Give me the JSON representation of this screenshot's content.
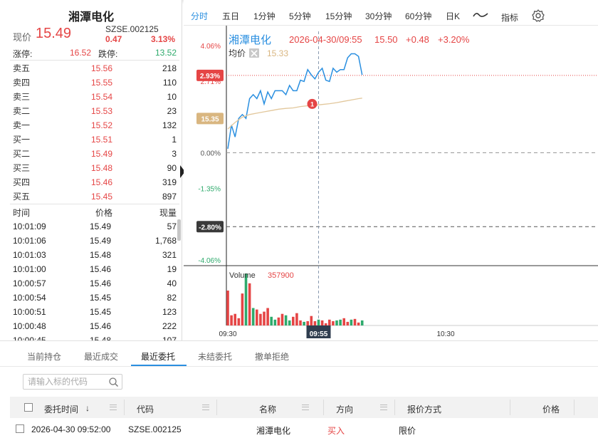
{
  "stock": {
    "name": "湘潭电化",
    "code": "SZSE.002125",
    "price_label": "现价",
    "price": "15.49",
    "change_abs": "0.47",
    "change_pct": "3.13%",
    "limit_up_label": "涨停:",
    "limit_up": "16.52",
    "limit_down_label": "跌停:",
    "limit_down": "13.52"
  },
  "orderbook": [
    {
      "label": "卖五",
      "price": "15.56",
      "volume": "218"
    },
    {
      "label": "卖四",
      "price": "15.55",
      "volume": "110"
    },
    {
      "label": "卖三",
      "price": "15.54",
      "volume": "10"
    },
    {
      "label": "卖二",
      "price": "15.53",
      "volume": "23"
    },
    {
      "label": "卖一",
      "price": "15.52",
      "volume": "132"
    },
    {
      "label": "买一",
      "price": "15.51",
      "volume": "1"
    },
    {
      "label": "买二",
      "price": "15.49",
      "volume": "3"
    },
    {
      "label": "买三",
      "price": "15.48",
      "volume": "90"
    },
    {
      "label": "买四",
      "price": "15.46",
      "volume": "319"
    },
    {
      "label": "买五",
      "price": "15.45",
      "volume": "897"
    }
  ],
  "ticks": {
    "headers": [
      "时间",
      "价格",
      "现量"
    ],
    "rows": [
      {
        "time": "10:01:09",
        "price": "15.49",
        "volume": "57"
      },
      {
        "time": "10:01:06",
        "price": "15.49",
        "volume": "1,768"
      },
      {
        "time": "10:01:03",
        "price": "15.48",
        "volume": "321"
      },
      {
        "time": "10:01:00",
        "price": "15.46",
        "volume": "19"
      },
      {
        "time": "10:00:57",
        "price": "15.46",
        "volume": "40"
      },
      {
        "time": "10:00:54",
        "price": "15.45",
        "volume": "82"
      },
      {
        "time": "10:00:51",
        "price": "15.45",
        "volume": "123"
      },
      {
        "time": "10:00:48",
        "price": "15.46",
        "volume": "222"
      },
      {
        "time": "10:00:45",
        "price": "15.48",
        "volume": "107"
      }
    ]
  },
  "periods": [
    "分时",
    "五日",
    "1分钟",
    "5分钟",
    "15分钟",
    "30分钟",
    "60分钟",
    "日K"
  ],
  "active_period": "分时",
  "indicator_label": "指标",
  "legend": {
    "name": "湘潭电化",
    "datetime": "2026-04-30/09:55",
    "price": "15.50",
    "change": "+0.48",
    "change_pct": "+3.20%",
    "avg_label": "均价",
    "avg_value": "15.33",
    "volume_label": "Volume",
    "volume_value": "357900"
  },
  "chart_data": {
    "type": "line",
    "y_ticks": [
      "4.06%",
      "2.71%",
      "1.35%",
      "0.00%",
      "-1.35%",
      "-2.71%",
      "-4.06%"
    ],
    "y_tick_values": [
      4.06,
      2.71,
      1.35,
      0.0,
      -1.35,
      -2.71,
      -4.06
    ],
    "ylim": [
      -4.06,
      4.06
    ],
    "x_ticks": [
      "09:30",
      "10:30"
    ],
    "x_tick_minutes": [
      0,
      60
    ],
    "crosshair": {
      "x_label": "09:55",
      "x_minute": 25
    },
    "price_tag": {
      "label": "2.93%",
      "value": 2.93
    },
    "avg_tag": {
      "label": "15.35",
      "value": 1.0
    },
    "low_tag": {
      "label": "-2.80%",
      "value": -2.8
    },
    "marker": {
      "label": "1",
      "minute": 25,
      "value": 1.85
    },
    "series": [
      {
        "name": "湘潭电化",
        "color": "#2a8fe0",
        "minutes": [
          0,
          1,
          2,
          3,
          4,
          5,
          6,
          7,
          8,
          9,
          10,
          11,
          12,
          13,
          14,
          15,
          16,
          17,
          18,
          19,
          20,
          21,
          22,
          23,
          24,
          25,
          26,
          27,
          28,
          29,
          30,
          31,
          32,
          33,
          34,
          35,
          36,
          37
        ],
        "values": [
          0.15,
          1.05,
          0.6,
          1.3,
          1.45,
          1.3,
          2.05,
          2.2,
          2.05,
          2.35,
          1.85,
          2.3,
          2.05,
          2.35,
          2.35,
          2.35,
          2.2,
          2.55,
          2.35,
          2.35,
          2.75,
          2.7,
          3.15,
          2.95,
          2.8,
          3.05,
          3.2,
          2.75,
          2.7,
          3.2,
          3.05,
          3.15,
          3.15,
          3.6,
          3.75,
          3.75,
          3.65,
          2.95
        ]
      },
      {
        "name": "均价",
        "color": "#e2c79b",
        "minutes": [
          0,
          2,
          4,
          6,
          8,
          10,
          12,
          14,
          16,
          18,
          20,
          22,
          24,
          26,
          28,
          30,
          32,
          34,
          36,
          37
        ],
        "values": [
          0.9,
          1.15,
          1.35,
          1.45,
          1.5,
          1.55,
          1.6,
          1.65,
          1.68,
          1.7,
          1.75,
          1.78,
          1.8,
          1.83,
          1.86,
          1.9,
          1.95,
          2.0,
          2.05,
          2.07
        ]
      }
    ],
    "volume": {
      "label": "Volume",
      "ymax": 357900,
      "bars": [
        {
          "v": 240000,
          "d": "up"
        },
        {
          "v": 70000,
          "d": "up"
        },
        {
          "v": 80000,
          "d": "up"
        },
        {
          "v": 50000,
          "d": "up"
        },
        {
          "v": 220000,
          "d": "up"
        },
        {
          "v": 357900,
          "d": "down"
        },
        {
          "v": 290000,
          "d": "up"
        },
        {
          "v": 120000,
          "d": "down"
        },
        {
          "v": 110000,
          "d": "up"
        },
        {
          "v": 80000,
          "d": "up"
        },
        {
          "v": 95000,
          "d": "up"
        },
        {
          "v": 120000,
          "d": "up"
        },
        {
          "v": 60000,
          "d": "down"
        },
        {
          "v": 40000,
          "d": "down"
        },
        {
          "v": 55000,
          "d": "up"
        },
        {
          "v": 80000,
          "d": "up"
        },
        {
          "v": 70000,
          "d": "down"
        },
        {
          "v": 35000,
          "d": "down"
        },
        {
          "v": 60000,
          "d": "up"
        },
        {
          "v": 85000,
          "d": "up"
        },
        {
          "v": 35000,
          "d": "up"
        },
        {
          "v": 25000,
          "d": "down"
        },
        {
          "v": 30000,
          "d": "up"
        },
        {
          "v": 65000,
          "d": "up"
        },
        {
          "v": 30000,
          "d": "up"
        },
        {
          "v": 40000,
          "d": "down"
        },
        {
          "v": 35000,
          "d": "up"
        },
        {
          "v": 15000,
          "d": "up"
        },
        {
          "v": 40000,
          "d": "up"
        },
        {
          "v": 30000,
          "d": "up"
        },
        {
          "v": 35000,
          "d": "down"
        },
        {
          "v": 40000,
          "d": "down"
        },
        {
          "v": 50000,
          "d": "up"
        },
        {
          "v": 25000,
          "d": "up"
        },
        {
          "v": 40000,
          "d": "down"
        },
        {
          "v": 45000,
          "d": "up"
        },
        {
          "v": 20000,
          "d": "up"
        },
        {
          "v": 35000,
          "d": "down"
        }
      ]
    },
    "colors": {
      "up": "#e54545",
      "down": "#2eaa6c",
      "axis_pos": "#e54545",
      "axis_neg": "#2eaa6c"
    }
  },
  "bottom": {
    "tabs": [
      "当前持仓",
      "最近成交",
      "最近委托",
      "未结委托",
      "撤单拒绝"
    ],
    "active_tab": "最近委托",
    "search_placeholder": "请输入标的代码",
    "columns": [
      "委托时间",
      "代码",
      "名称",
      "方向",
      "报价方式",
      "价格"
    ],
    "sort_arrow": "↓",
    "rows": [
      {
        "time": "2026-04-30 09:52:00",
        "code": "SZSE.002125",
        "name": "湘潭电化",
        "direction": "买入",
        "quote_type": "限价"
      }
    ]
  }
}
